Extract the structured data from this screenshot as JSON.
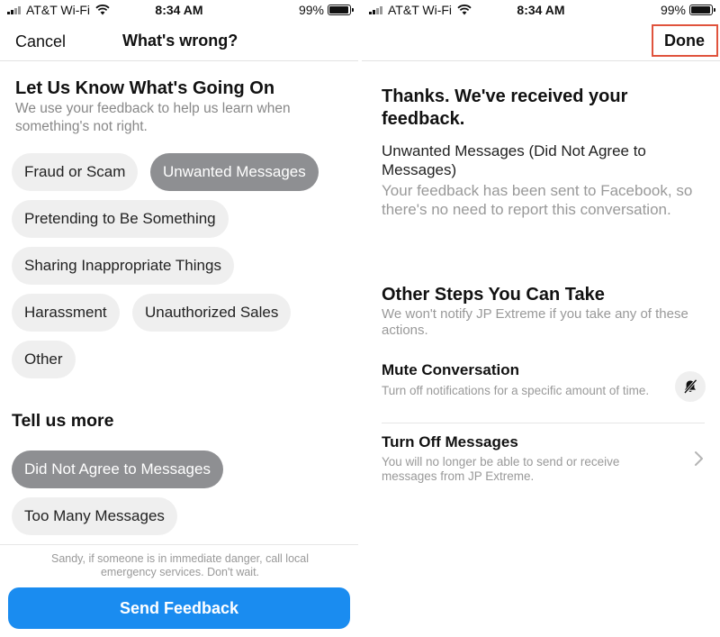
{
  "status": {
    "carrier": "AT&T Wi-Fi",
    "time": "8:34 AM",
    "battery": "99%"
  },
  "left": {
    "cancel": "Cancel",
    "title": "What's wrong?",
    "heading": "Let Us Know What's Going On",
    "subheading": "We use your feedback to help us learn when something's not right.",
    "categories": [
      {
        "label": "Fraud or Scam",
        "selected": false
      },
      {
        "label": "Unwanted Messages",
        "selected": true
      },
      {
        "label": "Pretending to Be Something",
        "selected": false
      },
      {
        "label": "Sharing Inappropriate Things",
        "selected": false
      },
      {
        "label": "Harassment",
        "selected": false
      },
      {
        "label": "Unauthorized Sales",
        "selected": false
      },
      {
        "label": "Other",
        "selected": false
      }
    ],
    "tell_more": "Tell us more",
    "reasons": [
      {
        "label": "Did Not Agree to Messages",
        "selected": true
      },
      {
        "label": "Too Many Messages",
        "selected": false
      }
    ],
    "warning": "Sandy, if someone is in immediate danger, call local emergency services. Don't wait.",
    "send": "Send Feedback"
  },
  "right": {
    "done": "Done",
    "thanks": "Thanks. We've received your feedback.",
    "reason": "Unwanted Messages (Did Not Agree to Messages)",
    "sent": "Your feedback has been sent to Facebook, so there's no need to report this conversation.",
    "steps_heading": "Other Steps You Can Take",
    "steps_sub": "We won't notify JP Extreme if you take any of these actions.",
    "mute_title": "Mute Conversation",
    "mute_desc": "Turn off notifications for a specific amount of time.",
    "turnoff_title": "Turn Off Messages",
    "turnoff_desc": "You will no longer be able to send or receive messages from JP Extreme."
  },
  "colors": {
    "accent": "#1a8cf0",
    "chip": "#efefef",
    "chip_selected": "#8e8f92",
    "highlight": "#e0533d"
  },
  "icons": [
    "wifi-icon",
    "battery-icon",
    "bell-off-icon",
    "chevron-right-icon"
  ]
}
